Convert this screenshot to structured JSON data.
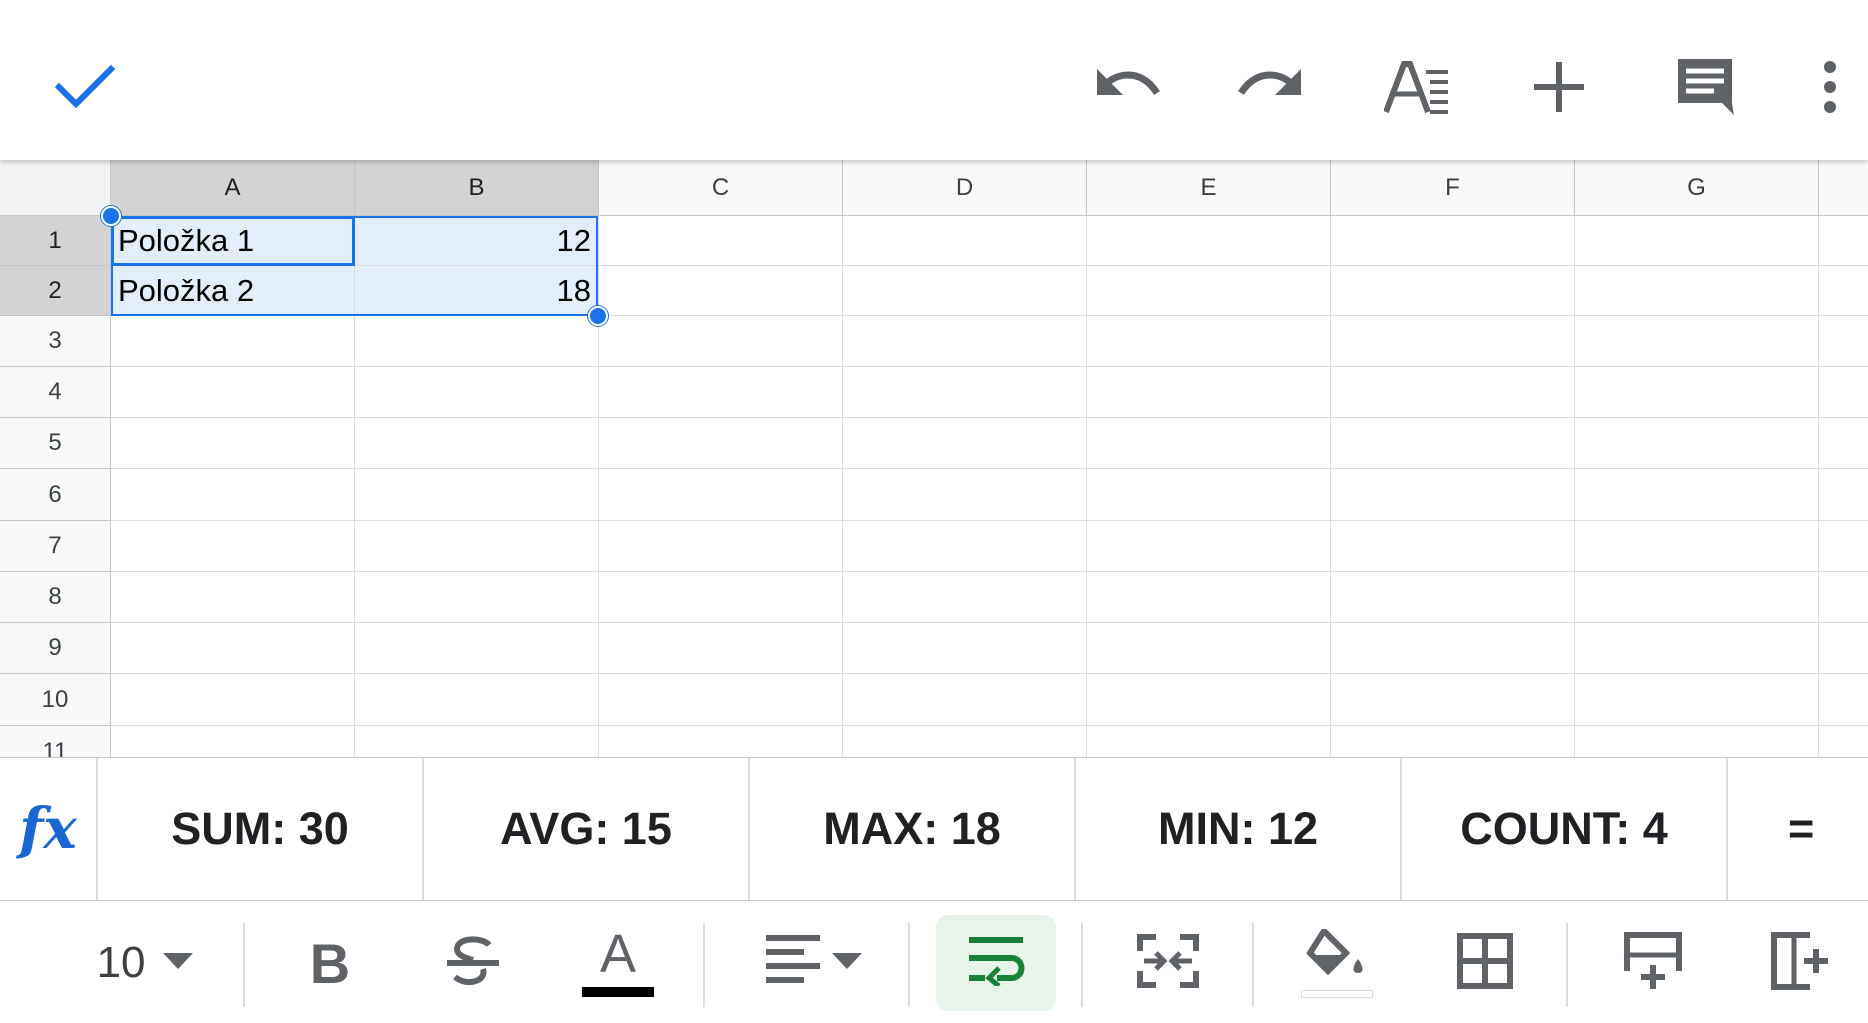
{
  "toolbar": {
    "done_icon": "check-icon",
    "undo_icon": "undo-icon",
    "redo_icon": "redo-icon",
    "text_format_icon": "text-format-icon",
    "insert_icon": "plus-icon",
    "comment_icon": "comment-icon",
    "more_icon": "more-vert-icon"
  },
  "grid": {
    "columns": [
      "A",
      "B",
      "C",
      "D",
      "E",
      "F",
      "G"
    ],
    "rows": [
      "1",
      "2",
      "3",
      "4",
      "5",
      "6",
      "7",
      "8",
      "9",
      "10",
      "11"
    ],
    "cells": {
      "A1": "Položka 1",
      "B1": "12",
      "A2": "Položka 2",
      "B2": "18"
    },
    "selection": "A1:B2"
  },
  "stats": {
    "fx": "fx",
    "sum": "SUM: 30",
    "avg": "AVG: 15",
    "max": "MAX: 18",
    "min": "MIN: 12",
    "count": "COUNT: 4",
    "more": "="
  },
  "format": {
    "font_size": "10",
    "bold": "B",
    "text_color_letter": "A",
    "accent_color": "#1a73e8",
    "wrap_active_color": "#188038"
  }
}
